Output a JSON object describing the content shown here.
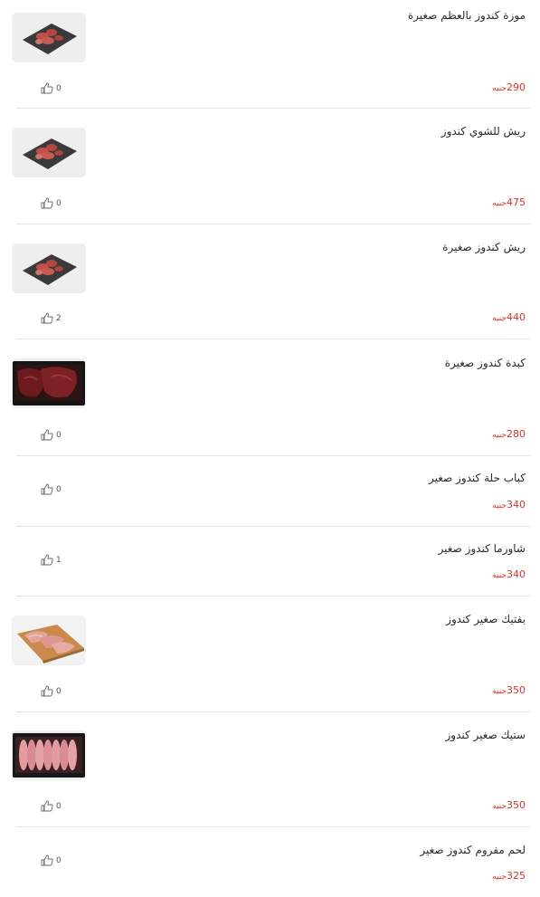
{
  "products": [
    {
      "title": "موزة كندوز بالعظم صغيرة",
      "price": "290",
      "currency": "جنيه",
      "likes": "0",
      "image": "slate-board-meat"
    },
    {
      "title": "ريش للشوي كندوز",
      "price": "475",
      "currency": "جنيه",
      "likes": "0",
      "image": "slate-board-meat"
    },
    {
      "title": "ريش كندوز صغيرة",
      "price": "440",
      "currency": "جنيه",
      "likes": "2",
      "image": "slate-board-meat"
    },
    {
      "title": "كبدة كندوز صغيرة",
      "price": "280",
      "currency": "جنيه",
      "likes": "0",
      "image": "liver-tray"
    },
    {
      "title": "كباب حلة كندوز صغير",
      "price": "340",
      "currency": "جنيه",
      "likes": "0",
      "image": null
    },
    {
      "title": "شاورما كندوز صغير",
      "price": "340",
      "currency": "جنيه",
      "likes": "1",
      "image": null
    },
    {
      "title": "بفتيك صغير كندوز",
      "price": "350",
      "currency": "جنيه",
      "likes": "0",
      "image": "wood-board-steak"
    },
    {
      "title": "ستيك صغير كندوز",
      "price": "350",
      "currency": "جنيه",
      "likes": "0",
      "image": "steak-tray"
    },
    {
      "title": "لحم مفروم كندوز صغير",
      "price": "325",
      "currency": "جنيه",
      "likes": "0",
      "image": null
    }
  ],
  "colors": {
    "price": "#d0342c",
    "divider": "#e4e4e4",
    "text": "#2a2a2a"
  },
  "like_icon": "thumbs-up-icon"
}
